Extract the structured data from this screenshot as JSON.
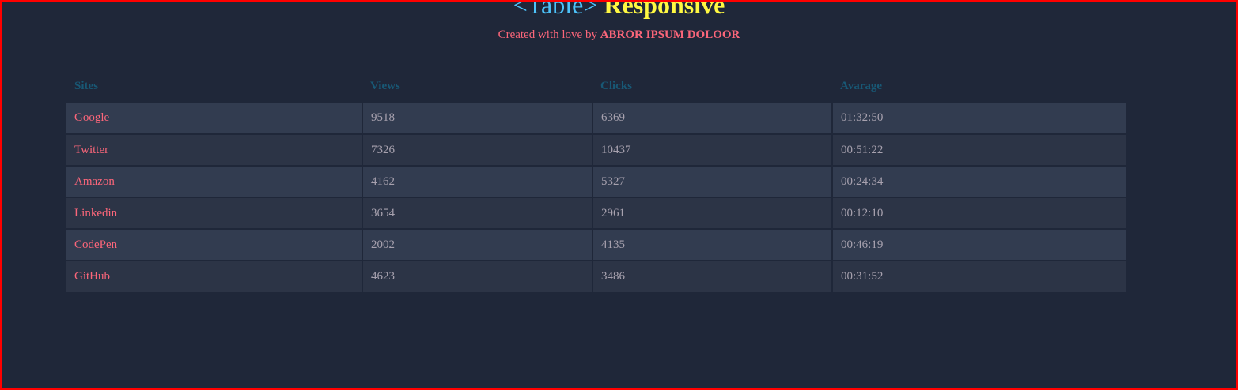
{
  "header": {
    "title_tag": "<Table>",
    "title_word": "Responsive",
    "subtitle_prefix": "Created with love by",
    "author": "ABROR IPSUM DOLOOR"
  },
  "table": {
    "columns": [
      "Sites",
      "Views",
      "Clicks",
      "Avarage"
    ],
    "rows": [
      [
        "Google",
        "9518",
        "6369",
        "01:32:50"
      ],
      [
        "Twitter",
        "7326",
        "10437",
        "00:51:22"
      ],
      [
        "Amazon",
        "4162",
        "5327",
        "00:24:34"
      ],
      [
        "Linkedin",
        "3654",
        "2961",
        "00:12:10"
      ],
      [
        "CodePen",
        "2002",
        "4135",
        "00:46:19"
      ],
      [
        "GitHub",
        "4623",
        "3486",
        "00:31:52"
      ]
    ]
  },
  "colors": {
    "background": "#1f2739",
    "title_blue": "#4dc3fa",
    "title_yellow": "#fff842",
    "accent_red": "#fb667a",
    "header_text": "#185875",
    "cell_text": "#a7a1ae",
    "row_odd": "#323c50",
    "row_even": "#2c3446",
    "frame": "#ff0000"
  }
}
